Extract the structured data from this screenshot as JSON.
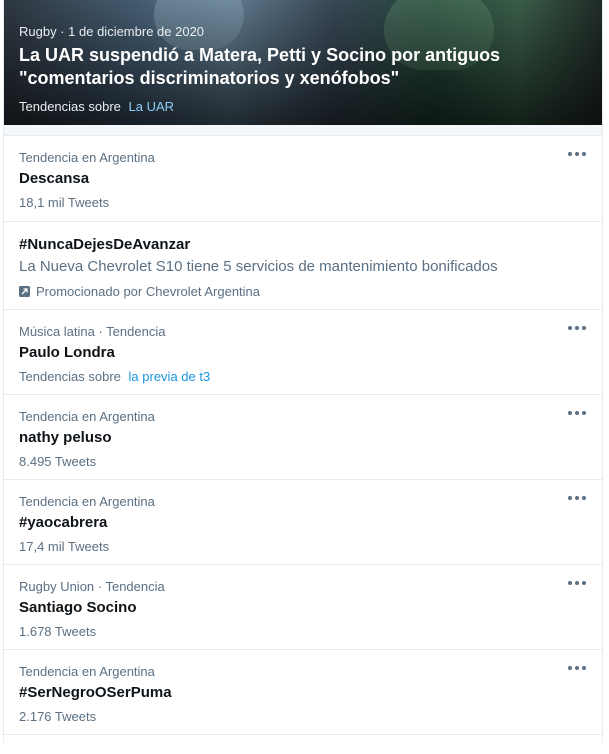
{
  "hero": {
    "category": "Rugby",
    "date": "1 de diciembre de 2020",
    "title": "La UAR suspendió a Matera, Petti y Socino por antiguos \"comentarios discriminatorios y xenófobos\"",
    "trends_label": "Tendencias sobre",
    "trends_link": "La UAR"
  },
  "trends": [
    {
      "context": "Tendencia en Argentina",
      "name": "Descansa",
      "count": "18,1 mil Tweets"
    },
    {
      "context": "Música latina · Tendencia",
      "name": "Paulo Londra",
      "count": "Tendencias sobre",
      "link": "la previa de t3"
    },
    {
      "context": "Tendencia en Argentina",
      "name": "nathy peluso",
      "count": "8.495 Tweets"
    },
    {
      "context": "Tendencia en Argentina",
      "name": "#yaocabrera",
      "count": "17,4 mil Tweets"
    },
    {
      "context": "Rugby Union · Tendencia",
      "name": "Santiago Socino",
      "count": "1.678 Tweets"
    },
    {
      "context": "Tendencia en Argentina",
      "name": "#SerNegroOSerPuma",
      "count": "2.176 Tweets"
    }
  ],
  "promoted": {
    "name": "#NuncaDejesDeAvanzar",
    "description": "La Nueva Chevrolet S10 tiene 5 servicios de mantenimiento bonificados",
    "sponsor": "Promocionado por Chevrolet Argentina"
  },
  "icons": {
    "more": "more-dots-icon",
    "promoted": "promoted-arrow-icon"
  },
  "colors": {
    "link": "#1b95e0",
    "secondary_text": "#5b7083",
    "divider": "#e6ecf0"
  }
}
